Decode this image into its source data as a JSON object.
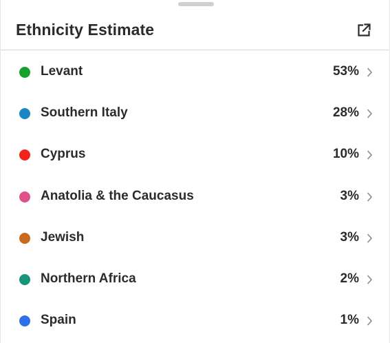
{
  "header": {
    "title": "Ethnicity Estimate",
    "action_icon": "external-link-icon"
  },
  "regions": [
    {
      "name": "Levant",
      "percent": "53%",
      "color": "#15a12b"
    },
    {
      "name": "Southern Italy",
      "percent": "28%",
      "color": "#1a86c4"
    },
    {
      "name": "Cyprus",
      "percent": "10%",
      "color": "#f2231a"
    },
    {
      "name": "Anatolia & the Caucasus",
      "percent": "3%",
      "color": "#de4f8c"
    },
    {
      "name": "Jewish",
      "percent": "3%",
      "color": "#c96a1c"
    },
    {
      "name": "Northern Africa",
      "percent": "2%",
      "color": "#17947a"
    },
    {
      "name": "Spain",
      "percent": "1%",
      "color": "#2f6fe8"
    }
  ],
  "row_icon": "chevron-right-icon",
  "colors": {
    "text": "#2b2b2b",
    "divider": "#d6d6d6",
    "chevron": "#8a8a8a"
  }
}
